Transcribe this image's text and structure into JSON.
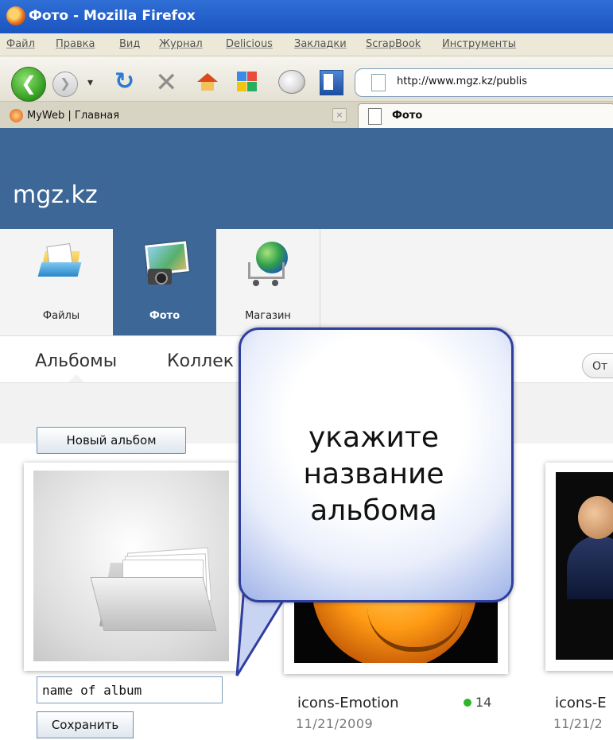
{
  "browser": {
    "title": "Фото - Mozilla Firefox",
    "menu": [
      "Файл",
      "Правка",
      "Вид",
      "Журнал",
      "Delicious",
      "Закладки",
      "ScrapBook",
      "Инструменты"
    ],
    "url": "http://www.mgz.kz/publis",
    "tabs": [
      {
        "label": "MyWeb | Главная"
      },
      {
        "label": "Фото"
      }
    ]
  },
  "site": {
    "logo": "mgz.kz",
    "apps": [
      {
        "label": "Файлы",
        "icon": "files-icon",
        "active": false
      },
      {
        "label": "Фото",
        "icon": "photo-icon",
        "active": true
      },
      {
        "label": "Магазин",
        "icon": "shop-icon",
        "active": false
      }
    ],
    "subnav": {
      "albums": "Альбомы",
      "collections": "Коллек",
      "right_pill": "От"
    },
    "toolbar": {
      "new_album": "Новый альбом"
    }
  },
  "albums": [
    {
      "input_value": "name of album",
      "save_label": "Сохранить"
    },
    {
      "title": "icons-Emotion",
      "count": "14",
      "date": "11/21/2009"
    },
    {
      "title": "icons-E",
      "date": "11/21/2"
    }
  ],
  "callout": {
    "lines": [
      "укажите",
      "название",
      "альбома"
    ]
  },
  "colors": {
    "site_header": "#3c6796",
    "callout_border": "#2f3fa0",
    "count_dot": "#2fb52a"
  }
}
